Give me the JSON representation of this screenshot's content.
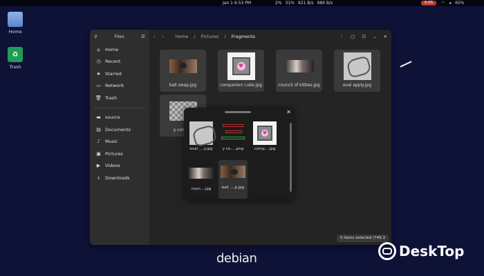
{
  "topbar": {
    "clock": "Jan 1   6:53 PM",
    "tray": [
      "2%",
      "31%",
      "921 B/s",
      "989 B/s"
    ],
    "recording": "0:05",
    "battery": "65%"
  },
  "desktop": {
    "icons": [
      {
        "label": "Home",
        "icon": "home-folder-icon"
      },
      {
        "label": "Trash",
        "icon": "trash-icon"
      }
    ],
    "branding": "debian",
    "watermark": "DeskTop"
  },
  "files_window": {
    "sidebar_title": "Files",
    "sidebar": [
      {
        "label": "Home",
        "icon": "home-icon"
      },
      {
        "label": "Recent",
        "icon": "clock-icon"
      },
      {
        "label": "Starred",
        "icon": "star-icon"
      },
      {
        "label": "Network",
        "icon": "network-icon"
      },
      {
        "label": "Trash",
        "icon": "trash-icon"
      },
      {
        "label": "source",
        "icon": "folder-icon"
      },
      {
        "label": "Documents",
        "icon": "documents-icon"
      },
      {
        "label": "Music",
        "icon": "music-icon"
      },
      {
        "label": "Pictures",
        "icon": "pictures-icon"
      },
      {
        "label": "Videos",
        "icon": "videos-icon"
      },
      {
        "label": "Downloads",
        "icon": "downloads-icon"
      }
    ],
    "breadcrumbs": [
      "Home",
      "Pictures",
      "Fragments"
    ],
    "files": [
      {
        "name": "ball swap.jpg",
        "selected": true
      },
      {
        "name": "companion cube.jpg",
        "selected": true
      },
      {
        "name": "council of kitties.jpg",
        "selected": true
      },
      {
        "name": "eval apply.jpg",
        "selected": true
      },
      {
        "name": "y combin",
        "selected": true
      }
    ],
    "status": "5 items selected  (749.3"
  },
  "drag_popup": {
    "items": [
      {
        "name": "eval ....y.jpg"
      },
      {
        "name": "y co.....png"
      },
      {
        "name": "comp....jpg"
      },
      {
        "name": "coun....jpg"
      },
      {
        "name": "ball ....p.jpg"
      }
    ]
  }
}
